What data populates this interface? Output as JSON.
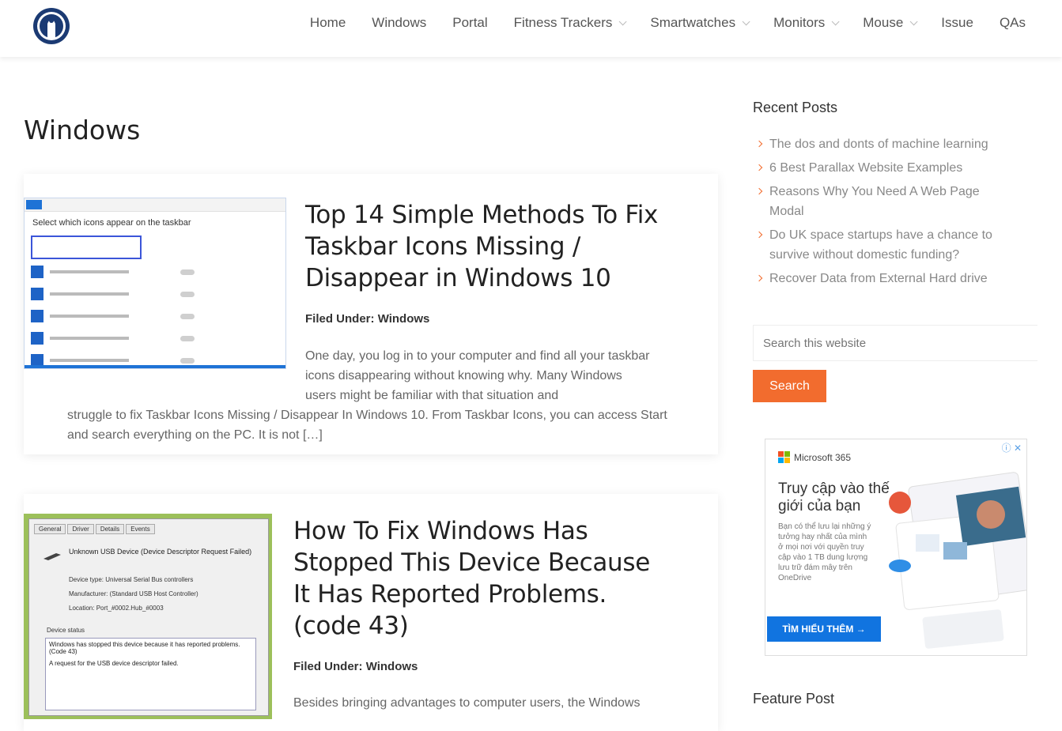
{
  "header": {
    "nav": [
      {
        "label": "Home",
        "has_dropdown": false
      },
      {
        "label": "Windows",
        "has_dropdown": false
      },
      {
        "label": "Portal",
        "has_dropdown": false
      },
      {
        "label": "Fitness Trackers",
        "has_dropdown": true
      },
      {
        "label": "Smartwatches",
        "has_dropdown": true
      },
      {
        "label": "Monitors",
        "has_dropdown": true
      },
      {
        "label": "Mouse",
        "has_dropdown": true
      },
      {
        "label": "Issue",
        "has_dropdown": false
      },
      {
        "label": "QAs",
        "has_dropdown": false
      }
    ]
  },
  "main": {
    "page_title": "Windows",
    "posts": [
      {
        "title": "Top 14 Simple Methods To Fix Taskbar Icons Missing / Disappear in Windows 10",
        "filed_label": "Filed Under:",
        "category": "Windows",
        "excerpt_a": "One day, you log in to your computer and find all your taskbar icons disappearing without knowing why. Many Windows users might be familiar with that situation and",
        "excerpt_b": "struggle to fix Taskbar Icons Missing / Disappear In Windows 10.  From Taskbar Icons, you can access Start and search everything on the PC. It is not […]",
        "thumb_heading": "Select which icons appear on the taskbar"
      },
      {
        "title": "How To Fix Windows Has Stopped This Device Because It Has Reported Problems. (code 43)",
        "filed_label": "Filed Under:",
        "category": "Windows",
        "excerpt_a": "Besides bringing advantages to computer users, the Windows",
        "thumb_tabs": [
          "General",
          "Driver",
          "Details",
          "Events"
        ],
        "thumb_device": "Unknown USB Device (Device Descriptor Request Failed)",
        "thumb_props": [
          "Device type:     Universal Serial Bus controllers",
          "Manufacturer:    (Standard USB Host Controller)",
          "Location:        Port_#0002.Hub_#0003"
        ],
        "thumb_status_label": "Device status",
        "thumb_status_1": "Windows has stopped this device because it has reported problems. (Code 43)",
        "thumb_status_2": "A request for the USB device descriptor failed."
      }
    ]
  },
  "sidebar": {
    "recent_heading": "Recent Posts",
    "recent_posts": [
      "The dos and donts of machine learning",
      "6 Best Parallax Website Examples",
      "Reasons Why You Need A Web Page Modal",
      "Do UK space startups have a chance to survive without domestic funding?",
      "Recover Data from External Hard drive"
    ],
    "search_placeholder": "Search this website",
    "search_button": "Search",
    "ad": {
      "brand": "Microsoft 365",
      "close": "ⓘ ✕",
      "title": "Truy cập vào thế giới của bạn",
      "body": "Bạn có thể lưu lại những ý tưởng hay nhất của mình ở mọi nơi với quyền truy cập vào 1 TB dung lượng lưu trữ đám mây trên OneDrive",
      "cta": "TÌM HIỂU THÊM →"
    },
    "feature_heading": "Feature Post"
  },
  "colors": {
    "accent": "#f26c2e",
    "link": "#1174e0",
    "logo": "#1b3a73"
  }
}
